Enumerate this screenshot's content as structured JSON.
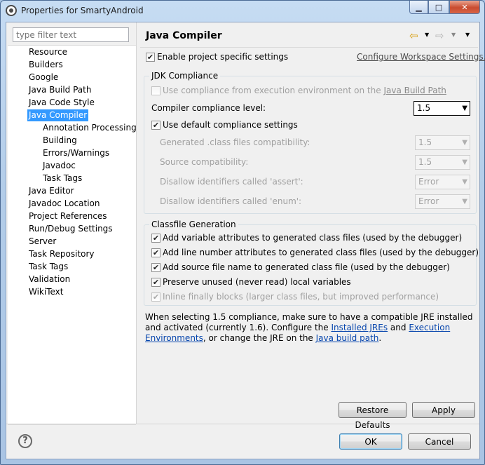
{
  "window": {
    "title": "Properties for SmartyAndroid",
    "buttons": {
      "minimize": "▁",
      "maximize": "□",
      "close": "✕"
    }
  },
  "filter": {
    "placeholder": "type filter text"
  },
  "nav": {
    "items": [
      {
        "label": "Resource",
        "level": 0
      },
      {
        "label": "Builders",
        "level": 0
      },
      {
        "label": "Google",
        "level": 0
      },
      {
        "label": "Java Build Path",
        "level": 0
      },
      {
        "label": "Java Code Style",
        "level": 0
      },
      {
        "label": "Java Compiler",
        "level": 0,
        "selected": true
      },
      {
        "label": "Annotation Processing",
        "level": 1
      },
      {
        "label": "Building",
        "level": 1
      },
      {
        "label": "Errors/Warnings",
        "level": 1
      },
      {
        "label": "Javadoc",
        "level": 1
      },
      {
        "label": "Task Tags",
        "level": 1
      },
      {
        "label": "Java Editor",
        "level": 0
      },
      {
        "label": "Javadoc Location",
        "level": 0
      },
      {
        "label": "Project References",
        "level": 0
      },
      {
        "label": "Run/Debug Settings",
        "level": 0
      },
      {
        "label": "Server",
        "level": 0
      },
      {
        "label": "Task Repository",
        "level": 0
      },
      {
        "label": "Task Tags",
        "level": 0
      },
      {
        "label": "Validation",
        "level": 0
      },
      {
        "label": "WikiText",
        "level": 0
      }
    ]
  },
  "page": {
    "title": "Java Compiler",
    "enable_specific": {
      "label": "Enable project specific settings",
      "checked": true
    },
    "configure_link": "Configure Workspace Settings...",
    "jdk": {
      "group_title": "JDK Compliance",
      "use_env": {
        "label": "Use compliance from execution environment on the",
        "link": "Java Build Path",
        "checked": false
      },
      "compliance_level": {
        "label": "Compiler compliance level:",
        "value": "1.5"
      },
      "use_default": {
        "label": "Use default compliance settings",
        "checked": true
      },
      "generated": {
        "label": "Generated .class files compatibility:",
        "value": "1.5"
      },
      "source": {
        "label": "Source compatibility:",
        "value": "1.5"
      },
      "assert": {
        "label": "Disallow identifiers called 'assert':",
        "value": "Error"
      },
      "enum": {
        "label": "Disallow identifiers called 'enum':",
        "value": "Error"
      }
    },
    "classfile": {
      "group_title": "Classfile Generation",
      "options": [
        {
          "label": "Add variable attributes to generated class files (used by the debugger)",
          "checked": true,
          "disabled": false
        },
        {
          "label": "Add line number attributes to generated class files (used by the debugger)",
          "checked": true,
          "disabled": false
        },
        {
          "label": "Add source file name to generated class file (used by the debugger)",
          "checked": true,
          "disabled": false
        },
        {
          "label": "Preserve unused (never read) local variables",
          "checked": true,
          "disabled": false
        },
        {
          "label": "Inline finally blocks (larger class files, but improved performance)",
          "checked": true,
          "disabled": true
        }
      ]
    },
    "info": {
      "text1": "When selecting 1.5 compliance, make sure to have a compatible JRE installed and activated (currently 1.6). Configure the ",
      "link1": "Installed JREs",
      "text2": " and ",
      "link2": "Execution Environments",
      "text3": ", or change the JRE on the ",
      "link3": "Java build path",
      "text4": "."
    },
    "restore_defaults": "Restore Defaults",
    "apply": "Apply"
  },
  "footer": {
    "help": "?",
    "ok": "OK",
    "cancel": "Cancel"
  }
}
